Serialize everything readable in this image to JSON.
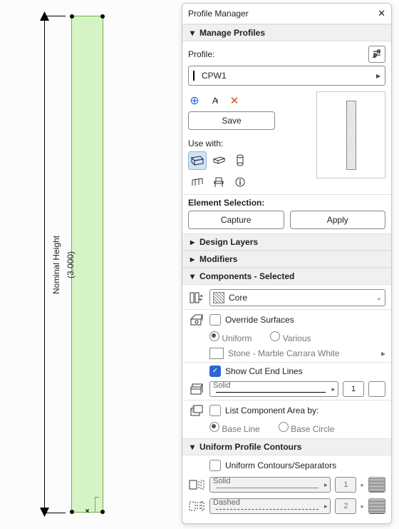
{
  "canvas": {
    "dimension_label": "Nominal Height",
    "dimension_value": "(3.000)"
  },
  "panel": {
    "title": "Profile Manager",
    "sections": {
      "manage": {
        "title": "Manage Profiles",
        "profile_label": "Profile:",
        "profile_name": "CPW1",
        "save_label": "Save",
        "use_with_label": "Use with:"
      },
      "element_selection": {
        "title": "Element Selection:",
        "capture_label": "Capture",
        "apply_label": "Apply"
      },
      "design_layers": {
        "title": "Design Layers"
      },
      "modifiers": {
        "title": "Modifiers"
      },
      "components": {
        "title": "Components - Selected",
        "dropdown": "Core",
        "override_label": "Override Surfaces",
        "uniform_label": "Uniform",
        "various_label": "Various",
        "surface_name": "Stone - Marble Carrara White",
        "cut_lines_label": "Show Cut End Lines",
        "line_style": "Solid",
        "line_weight": "1",
        "list_area_label": "List Component Area by:",
        "base_line_label": "Base Line",
        "base_circle_label": "Base Circle"
      },
      "contours": {
        "title": "Uniform Profile Contours",
        "uniform_label": "Uniform Contours/Separators",
        "line1_style": "Solid",
        "line1_weight": "1",
        "line2_style": "Dashed",
        "line2_weight": "2"
      }
    }
  }
}
